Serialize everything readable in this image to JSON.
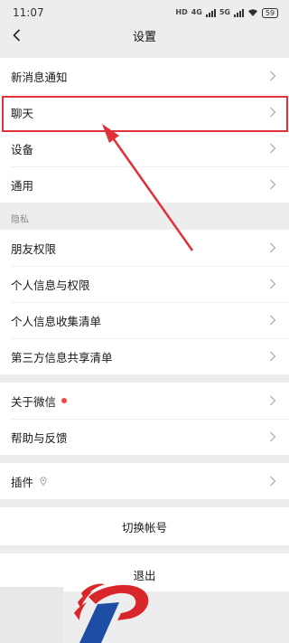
{
  "status_bar": {
    "time": "11:07",
    "hd_badge": "HD",
    "net1": "4G",
    "net2": "5G",
    "battery": "59"
  },
  "nav": {
    "title": "设置",
    "back_icon": "chevron-left-icon"
  },
  "groups": {
    "main": [
      {
        "label": "新消息通知"
      },
      {
        "label": "聊天"
      },
      {
        "label": "设备"
      },
      {
        "label": "通用"
      }
    ],
    "privacy_header": "隐私",
    "privacy": [
      {
        "label": "朋友权限"
      },
      {
        "label": "个人信息与权限"
      },
      {
        "label": "个人信息收集清单"
      },
      {
        "label": "第三方信息共享清单"
      }
    ],
    "about": [
      {
        "label": "关于微信",
        "badge": "red-dot"
      },
      {
        "label": "帮助与反馈"
      }
    ],
    "plugins": [
      {
        "label": "插件",
        "icon": "location-pin-icon"
      }
    ]
  },
  "actions": {
    "switch_account": "切换帐号",
    "logout": "退出"
  },
  "annotation": {
    "highlight_color": "#e0303a",
    "arrow_color": "#e0303a"
  },
  "colors": {
    "background": "#ededed",
    "row_bg": "#ffffff",
    "logo_red": "#d8262b",
    "logo_blue": "#1d4ea3"
  }
}
